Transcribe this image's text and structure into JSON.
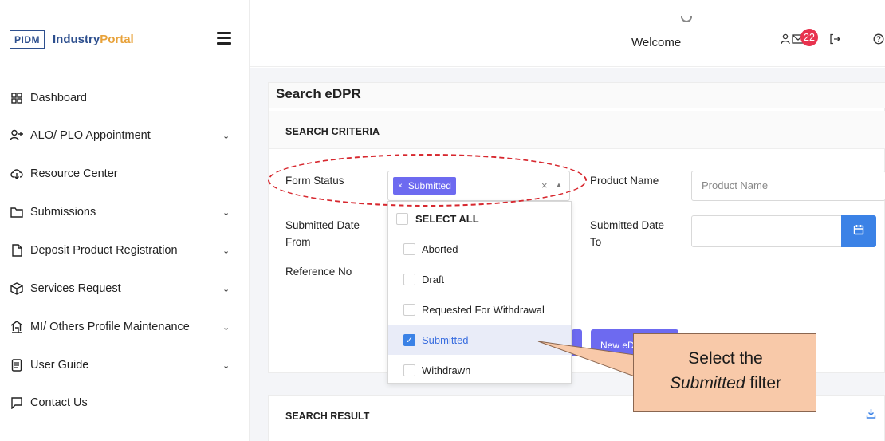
{
  "brand": {
    "logo_text": "PIDM",
    "name_part1": "Industry",
    "name_part2": "Portal"
  },
  "header": {
    "welcome": "Welcome",
    "mail_badge_count": "22"
  },
  "sidebar": {
    "items": [
      {
        "label": "Dashboard",
        "icon": "dashboard-grid-icon",
        "has_chevron": false
      },
      {
        "label": "ALO/ PLO Appointment",
        "icon": "user-add-icon",
        "has_chevron": true
      },
      {
        "label": "Resource Center",
        "icon": "cloud-download-icon",
        "has_chevron": false
      },
      {
        "label": "Submissions",
        "icon": "folder-icon",
        "has_chevron": true
      },
      {
        "label": "Deposit Product Registration",
        "icon": "document-icon",
        "has_chevron": true
      },
      {
        "label": "Services Request",
        "icon": "box-icon",
        "has_chevron": true
      },
      {
        "label": "MI/ Others Profile Maintenance",
        "icon": "bank-icon",
        "has_chevron": true
      },
      {
        "label": "User Guide",
        "icon": "book-icon",
        "has_chevron": true
      },
      {
        "label": "Contact Us",
        "icon": "chat-icon",
        "has_chevron": false
      }
    ]
  },
  "main": {
    "page_title": "Search eDPR",
    "criteria_title": "SEARCH CRITERIA",
    "form_status_label": "Form Status",
    "form_status_selected_chip": "Submitted",
    "product_name_label": "Product Name",
    "product_name_placeholder": "Product Name",
    "submitted_from_label_line1": "Submitted Date",
    "submitted_from_label_line2": "From",
    "submitted_to_label_line1": "Submitted Date",
    "submitted_to_label_line2": "To",
    "reference_no_label": "Reference No",
    "new_button_label": "New eD",
    "result_title": "SEARCH RESULT"
  },
  "dropdown": {
    "options": [
      {
        "label": "SELECT ALL",
        "checked": false,
        "bold": true
      },
      {
        "label": "Aborted",
        "checked": false
      },
      {
        "label": "Draft",
        "checked": false
      },
      {
        "label": "Requested For Withdrawal",
        "checked": false
      },
      {
        "label": "Submitted",
        "checked": true
      },
      {
        "label": "Withdrawn",
        "checked": false
      }
    ]
  },
  "callout": {
    "line1": "Select the",
    "line2_italic": "Submitted",
    "line2_rest": " filter"
  },
  "colors": {
    "accent_purple": "#6d6af0",
    "accent_blue": "#3b82e6",
    "badge_red": "#e8334f",
    "annotation_red": "#d7282f",
    "callout_fill": "#f8c9a9"
  }
}
